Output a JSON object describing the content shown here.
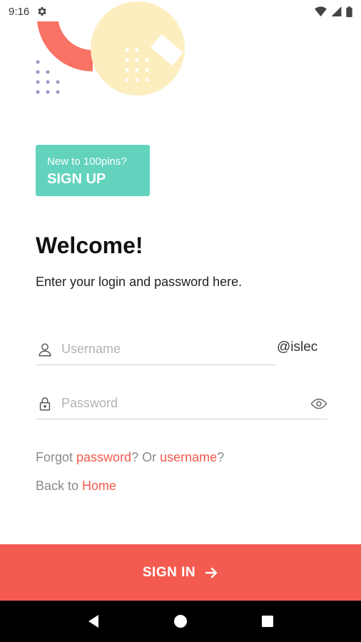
{
  "status_bar": {
    "time": "9:16",
    "icons": [
      "settings-icon",
      "wifi-icon",
      "signal-icon",
      "battery-icon"
    ]
  },
  "colors": {
    "accent": "#f45b50",
    "signup_bg": "#63d3bd",
    "decor_coral": "#f87366",
    "decor_cream": "#fdeec0",
    "decor_dots": "#9a97c4"
  },
  "signup": {
    "prompt": "New to 100pins?",
    "label": "SIGN UP"
  },
  "welcome": {
    "title": "Welcome!",
    "subtitle": "Enter your login and password here."
  },
  "form": {
    "username_placeholder": "Username",
    "username_value": "",
    "domain_suffix": "@islec",
    "password_placeholder": "Password",
    "password_value": ""
  },
  "links": {
    "forgot_prefix": "Forgot ",
    "forgot_password": "password",
    "forgot_middle": "? Or ",
    "forgot_username": "username",
    "forgot_suffix": "?",
    "back_prefix": "Back to ",
    "back_home": "Home"
  },
  "signin": {
    "label": "SIGN IN",
    "icon": "arrow-right-icon"
  },
  "nav": {
    "icons": [
      "back-icon",
      "home-icon",
      "recents-icon"
    ]
  }
}
